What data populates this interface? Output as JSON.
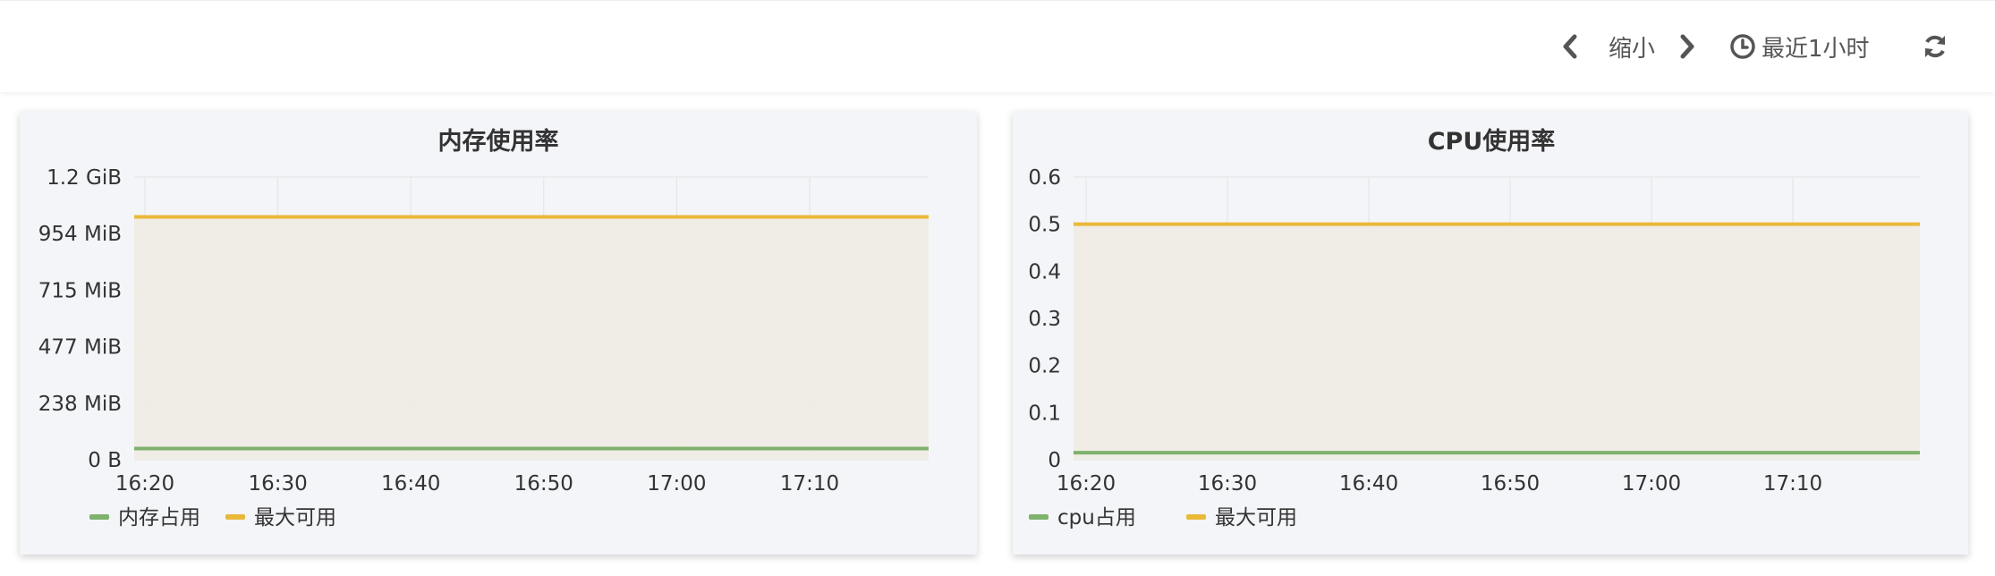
{
  "toolbar": {
    "zoom_label": "缩小",
    "time_range_label": "最近1小时",
    "icons": {
      "prev": "chevron-left-icon",
      "next": "chevron-right-icon",
      "clock": "clock-icon",
      "refresh": "refresh-icon"
    }
  },
  "colors": {
    "series_used": "#7eb26d",
    "series_max": "#eab839",
    "grid": "#e3e3e3",
    "fill": "#f0ece3"
  },
  "chart_data": [
    {
      "type": "line",
      "title": "内存使用率",
      "x": [
        "16:20",
        "16:30",
        "16:40",
        "16:50",
        "17:00",
        "17:10"
      ],
      "y_ticks": [
        "0 B",
        "238 MiB",
        "477 MiB",
        "715 MiB",
        "954 MiB",
        "1.2 GiB"
      ],
      "y_tick_values_mib": [
        0,
        238,
        477,
        715,
        954,
        1192
      ],
      "ylim_mib": [
        0,
        1192
      ],
      "grid": true,
      "legend": "bottom-left",
      "series": [
        {
          "name": "内存占用",
          "color": "#7eb26d",
          "value_mib": 47
        },
        {
          "name": "最大可用",
          "color": "#eab839",
          "value_mib": 1024,
          "fill": true
        }
      ]
    },
    {
      "type": "line",
      "title": "CPU使用率",
      "x": [
        "16:20",
        "16:30",
        "16:40",
        "16:50",
        "17:00",
        "17:10"
      ],
      "y_ticks": [
        "0",
        "0.1",
        "0.2",
        "0.3",
        "0.4",
        "0.5",
        "0.6"
      ],
      "ylim": [
        0,
        0.6
      ],
      "grid": true,
      "legend": "bottom-left",
      "series": [
        {
          "name": "cpu占用",
          "color": "#7eb26d",
          "value": 0.015
        },
        {
          "name": "最大可用",
          "color": "#eab839",
          "value": 0.5,
          "fill": true
        }
      ]
    }
  ]
}
